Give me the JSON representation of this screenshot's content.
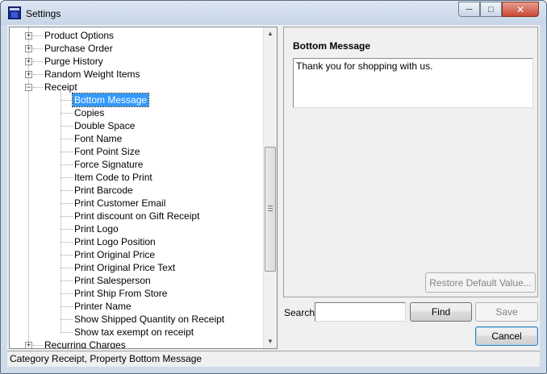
{
  "window": {
    "title": "Settings"
  },
  "tree": {
    "categories": [
      {
        "label": "Product Options",
        "expanded": false
      },
      {
        "label": "Purchase Order",
        "expanded": false
      },
      {
        "label": "Purge History",
        "expanded": false
      },
      {
        "label": "Random Weight Items",
        "expanded": false
      },
      {
        "label": "Receipt",
        "expanded": true
      },
      {
        "label": "Recurring Charges",
        "expanded": false
      }
    ],
    "receipt_children": [
      "Bottom Message",
      "Copies",
      "Double Space",
      "Font Name",
      "Font Point Size",
      "Force Signature",
      "Item Code to Print",
      "Print Barcode",
      "Print Customer Email",
      "Print discount on Gift Receipt",
      "Print Logo",
      "Print Logo Position",
      "Print Original Price",
      "Print Original Price Text",
      "Print Salesperson",
      "Print Ship From Store",
      "Printer Name",
      "Show Shipped Quantity on Receipt",
      "Show tax exempt on receipt"
    ],
    "selected": "Bottom Message"
  },
  "property": {
    "title": "Bottom Message",
    "value": "Thank you for shopping with us.",
    "restore_label": "Restore Default Value..."
  },
  "search": {
    "label": "Search",
    "value": ""
  },
  "buttons": {
    "find": "Find",
    "save": "Save",
    "cancel": "Cancel"
  },
  "status": "Category Receipt, Property Bottom Message",
  "colors": {
    "selection": "#3399ff",
    "window_frame": "#cfdbe9",
    "close_button": "#c74a36"
  }
}
